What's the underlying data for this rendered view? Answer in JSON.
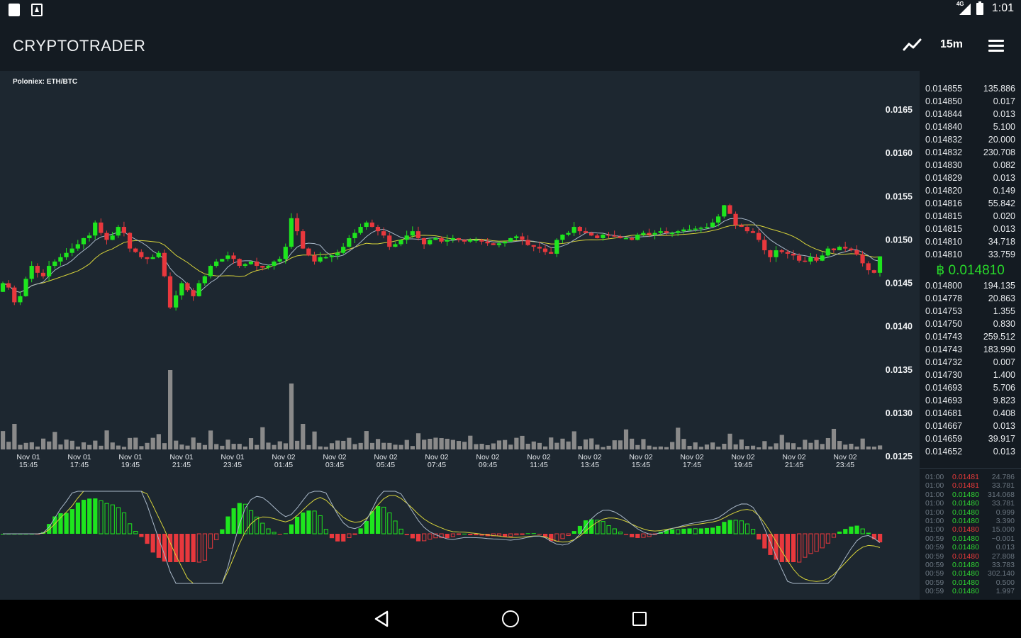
{
  "status_bar": {
    "time": "1:01",
    "network": "4G",
    "icons": [
      "sd-card-icon",
      "store-icon",
      "signal-icon",
      "battery-icon"
    ]
  },
  "app_bar": {
    "title": "CRYPTOTRADER",
    "interval": "15m",
    "icons": [
      "chart-line-icon",
      "menu-icon"
    ]
  },
  "colors": {
    "up": "#1ee51e",
    "down": "#e8383d",
    "ma_fast": "#a9b8c8",
    "ma_slow": "#d8d43a",
    "volume": "#8a8a8a",
    "background": "#1d2730",
    "panel": "#141b22"
  },
  "chart": {
    "pair_label": "Poloniex: ETH/BTC"
  },
  "chart_data": {
    "type": "candlestick",
    "title": "Poloniex: ETH/BTC",
    "y_ticks": [
      "0.0165",
      "0.0160",
      "0.0155",
      "0.0150",
      "0.0145",
      "0.0140",
      "0.0135",
      "0.0130",
      "0.0125"
    ],
    "ylim": [
      0.0125,
      0.0166
    ],
    "x_ticks": [
      [
        "Nov 01",
        "15:45"
      ],
      [
        "Nov 01",
        "17:45"
      ],
      [
        "Nov 01",
        "19:45"
      ],
      [
        "Nov 01",
        "21:45"
      ],
      [
        "Nov 01",
        "23:45"
      ],
      [
        "Nov 02",
        "01:45"
      ],
      [
        "Nov 02",
        "03:45"
      ],
      [
        "Nov 02",
        "05:45"
      ],
      [
        "Nov 02",
        "07:45"
      ],
      [
        "Nov 02",
        "09:45"
      ],
      [
        "Nov 02",
        "11:45"
      ],
      [
        "Nov 02",
        "13:45"
      ],
      [
        "Nov 02",
        "15:45"
      ],
      [
        "Nov 02",
        "17:45"
      ],
      [
        "Nov 02",
        "19:45"
      ],
      [
        "Nov 02",
        "21:45"
      ],
      [
        "Nov 02",
        "23:45"
      ]
    ],
    "close": [
      0.0145,
      0.01445,
      0.01428,
      0.01435,
      0.01455,
      0.0147,
      0.01462,
      0.01458,
      0.0147,
      0.01475,
      0.0148,
      0.01485,
      0.0149,
      0.01495,
      0.01502,
      0.01505,
      0.0152,
      0.01508,
      0.015,
      0.01505,
      0.01515,
      0.01508,
      0.0149,
      0.01486,
      0.0148,
      0.01478,
      0.0148,
      0.01485,
      0.01458,
      0.01422,
      0.01436,
      0.0145,
      0.01442,
      0.01435,
      0.0145,
      0.01458,
      0.0147,
      0.01475,
      0.01478,
      0.01482,
      0.01478,
      0.0147,
      0.01472,
      0.01475,
      0.0147,
      0.01468,
      0.0147,
      0.01475,
      0.01478,
      0.01492,
      0.01525,
      0.0151,
      0.0149,
      0.01482,
      0.01475,
      0.0148,
      0.0148,
      0.01482,
      0.01485,
      0.01492,
      0.01502,
      0.01508,
      0.01515,
      0.0152,
      0.01515,
      0.0151,
      0.01505,
      0.01492,
      0.01495,
      0.015,
      0.01505,
      0.0151,
      0.01502,
      0.01495,
      0.015,
      0.01502,
      0.01498,
      0.015,
      0.01502,
      0.015,
      0.01498,
      0.015,
      0.015,
      0.01498,
      0.01496,
      0.01494,
      0.01496,
      0.01498,
      0.01502,
      0.01504,
      0.015,
      0.01494,
      0.01492,
      0.0149,
      0.01486,
      0.01484,
      0.015,
      0.01506,
      0.01508,
      0.01515,
      0.0151,
      0.01508,
      0.01505,
      0.01502,
      0.01506,
      0.01505,
      0.01504,
      0.01502,
      0.01502,
      0.015,
      0.01506,
      0.01508,
      0.01506,
      0.01508,
      0.0151,
      0.01508,
      0.01508,
      0.0151,
      0.01512,
      0.01512,
      0.01513,
      0.01514,
      0.01515,
      0.0152,
      0.01527,
      0.0154,
      0.0153,
      0.01517,
      0.01515,
      0.0151,
      0.01508,
      0.015,
      0.01488,
      0.0148,
      0.01488,
      0.01486,
      0.01484,
      0.01482,
      0.01476,
      0.01475,
      0.0148,
      0.01476,
      0.01482,
      0.0149,
      0.01488,
      0.01492,
      0.0149,
      0.01488,
      0.01483,
      0.01473,
      0.01465,
      0.01462,
      0.01481
    ],
    "volume_note": "bars in the lower strip of the price chart",
    "macd_note": "histogram and two signal lines in the lower panel"
  },
  "orderbook": {
    "asks": [
      [
        "0.014855",
        "135.886"
      ],
      [
        "0.014850",
        "0.017"
      ],
      [
        "0.014844",
        "0.013"
      ],
      [
        "0.014840",
        "5.100"
      ],
      [
        "0.014832",
        "20.000"
      ],
      [
        "0.014832",
        "230.708"
      ],
      [
        "0.014830",
        "0.082"
      ],
      [
        "0.014829",
        "0.013"
      ],
      [
        "0.014820",
        "0.149"
      ],
      [
        "0.014816",
        "55.842"
      ],
      [
        "0.014815",
        "0.020"
      ],
      [
        "0.014815",
        "0.013"
      ],
      [
        "0.014810",
        "34.718"
      ],
      [
        "0.014810",
        "33.759"
      ]
    ],
    "last_price": "฿ 0.014810",
    "bids": [
      [
        "0.014800",
        "194.135"
      ],
      [
        "0.014778",
        "20.863"
      ],
      [
        "0.014753",
        "1.355"
      ],
      [
        "0.014750",
        "0.830"
      ],
      [
        "0.014743",
        "259.512"
      ],
      [
        "0.014743",
        "183.990"
      ],
      [
        "0.014732",
        "0.007"
      ],
      [
        "0.014730",
        "1.400"
      ],
      [
        "0.014693",
        "5.706"
      ],
      [
        "0.014693",
        "9.823"
      ],
      [
        "0.014681",
        "0.408"
      ],
      [
        "0.014667",
        "0.013"
      ],
      [
        "0.014659",
        "39.917"
      ],
      [
        "0.014652",
        "0.013"
      ]
    ]
  },
  "trades": [
    {
      "time": "01:00",
      "price": "0.01481",
      "amount": "24.786",
      "side": "sell"
    },
    {
      "time": "01:00",
      "price": "0.01481",
      "amount": "33.781",
      "side": "sell"
    },
    {
      "time": "01:00",
      "price": "0.01480",
      "amount": "314.068",
      "side": "buy"
    },
    {
      "time": "01:00",
      "price": "0.01480",
      "amount": "33.781",
      "side": "buy"
    },
    {
      "time": "01:00",
      "price": "0.01480",
      "amount": "0.999",
      "side": "buy"
    },
    {
      "time": "01:00",
      "price": "0.01480",
      "amount": "3.390",
      "side": "buy"
    },
    {
      "time": "01:00",
      "price": "0.01480",
      "amount": "15.000",
      "side": "sell"
    },
    {
      "time": "00:59",
      "price": "0.01480",
      "amount": "~0.001",
      "side": "buy"
    },
    {
      "time": "00:59",
      "price": "0.01480",
      "amount": "0.013",
      "side": "buy"
    },
    {
      "time": "00:59",
      "price": "0.01480",
      "amount": "27.808",
      "side": "sell"
    },
    {
      "time": "00:59",
      "price": "0.01480",
      "amount": "33.783",
      "side": "buy"
    },
    {
      "time": "00:59",
      "price": "0.01480",
      "amount": "302.140",
      "side": "buy"
    },
    {
      "time": "00:59",
      "price": "0.01480",
      "amount": "0.500",
      "side": "buy"
    },
    {
      "time": "00:59",
      "price": "0.01480",
      "amount": "1.997",
      "side": "buy"
    }
  ],
  "nav": {
    "icons": [
      "back-icon",
      "home-icon",
      "recents-icon"
    ]
  }
}
